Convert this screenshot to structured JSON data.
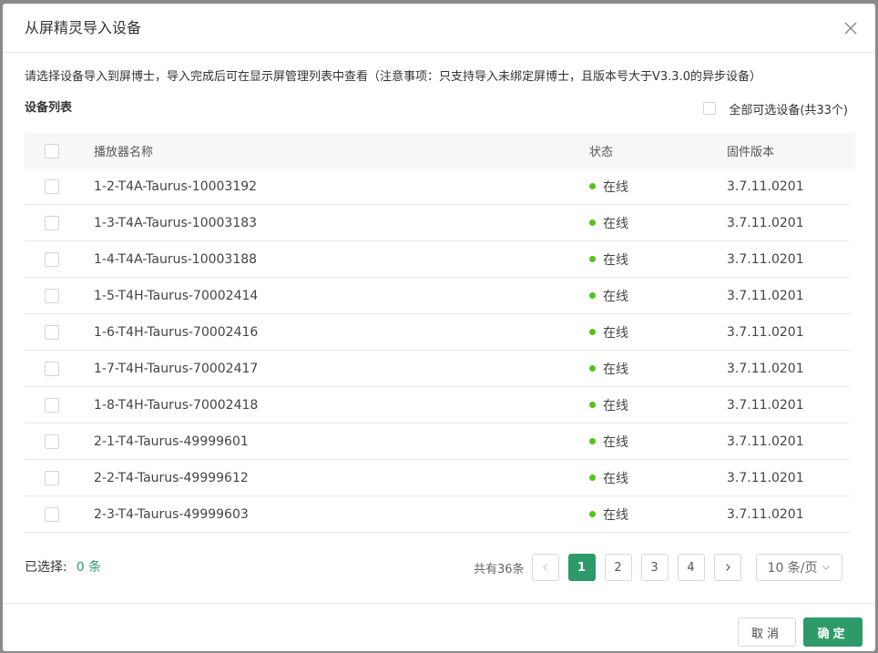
{
  "dialog": {
    "title": "从屏精灵导入设备",
    "close_icon": "close-icon",
    "notice": "请选择设备导入到屏博士，导入完成后可在显示屏管理列表中查看（注意事项：只支持导入未绑定屏博士，且版本号大于V3.3.0的异步设备）",
    "list_title": "设备列表",
    "select_all_label": "全部可选设备(共33个)"
  },
  "table": {
    "columns": [
      "播放器名称",
      "状态",
      "固件版本"
    ],
    "rows": [
      {
        "name": "1-2-T4A-Taurus-10003192",
        "status": "在线",
        "firmware": "3.7.11.0201"
      },
      {
        "name": "1-3-T4A-Taurus-10003183",
        "status": "在线",
        "firmware": "3.7.11.0201"
      },
      {
        "name": "1-4-T4A-Taurus-10003188",
        "status": "在线",
        "firmware": "3.7.11.0201"
      },
      {
        "name": "1-5-T4H-Taurus-70002414",
        "status": "在线",
        "firmware": "3.7.11.0201"
      },
      {
        "name": "1-6-T4H-Taurus-70002416",
        "status": "在线",
        "firmware": "3.7.11.0201"
      },
      {
        "name": "1-7-T4H-Taurus-70002417",
        "status": "在线",
        "firmware": "3.7.11.0201"
      },
      {
        "name": "1-8-T4H-Taurus-70002418",
        "status": "在线",
        "firmware": "3.7.11.0201"
      },
      {
        "name": "2-1-T4-Taurus-49999601",
        "status": "在线",
        "firmware": "3.7.11.0201"
      },
      {
        "name": "2-2-T4-Taurus-49999612",
        "status": "在线",
        "firmware": "3.7.11.0201"
      },
      {
        "name": "2-3-T4-Taurus-49999603",
        "status": "在线",
        "firmware": "3.7.11.0201"
      }
    ],
    "status_color": "#52c41a"
  },
  "footer": {
    "selected_label": "已选择:",
    "selected_count": "0 条",
    "total": "共有36条",
    "pages": [
      "1",
      "2",
      "3",
      "4"
    ],
    "current_page": "1",
    "page_size": "10 条/页",
    "cancel_label": "取消",
    "ok_label": "确定"
  },
  "colors": {
    "accent": "#2e9a6a"
  }
}
